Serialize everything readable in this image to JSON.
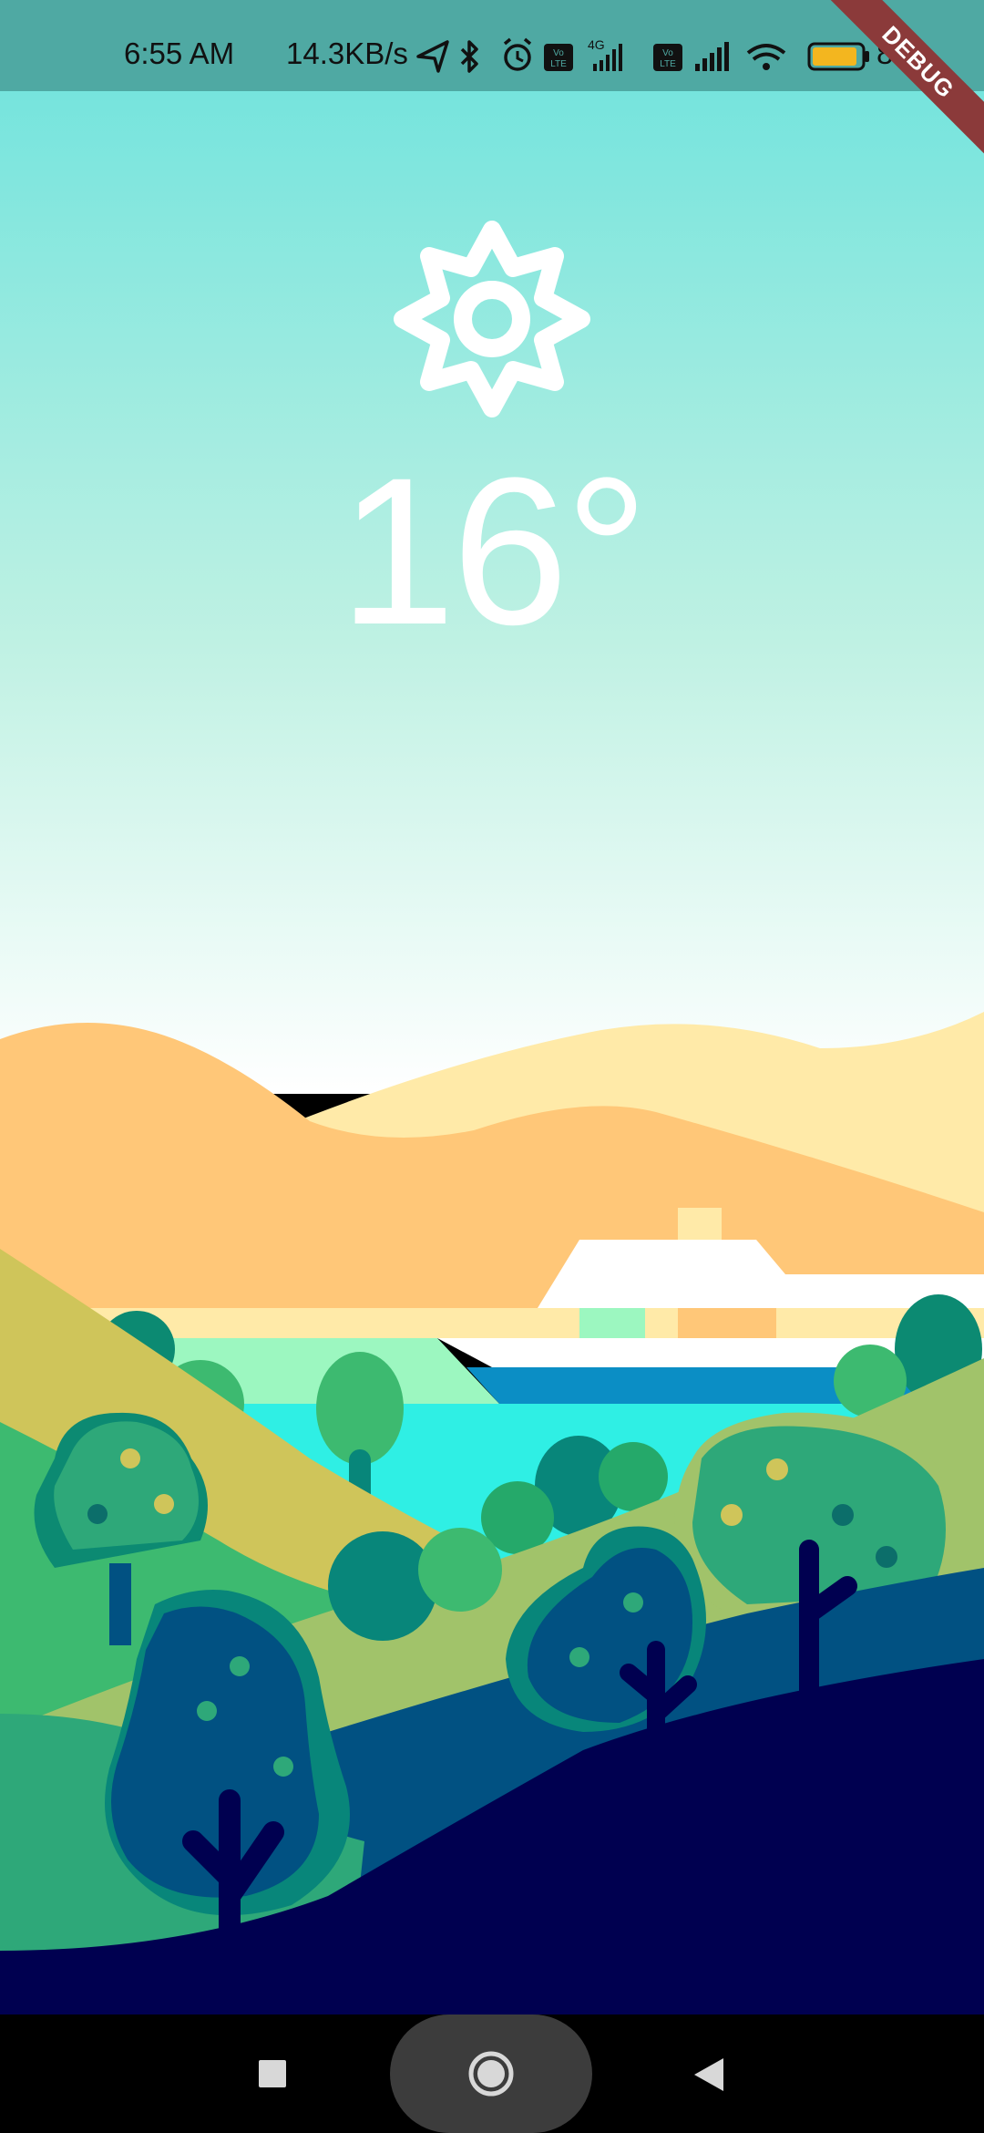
{
  "status_bar": {
    "time": "6:55 AM",
    "network_speed": "14.3KB/s",
    "battery_percent": "84",
    "icons": [
      "location-arrow-icon",
      "bluetooth-icon",
      "alarm-icon",
      "volte-icon",
      "signal-4g-icon",
      "volte-icon",
      "signal-icon",
      "wifi-icon",
      "battery-icon"
    ]
  },
  "debug_banner": "DEBUG",
  "weather": {
    "icon": "sun-icon",
    "temperature": "16°"
  },
  "colors": {
    "sky_top": "#76e4dd",
    "sky_bottom": "#ffffff",
    "status_bar": "#4fa9a3",
    "battery_fill": "#f3b61f"
  },
  "navigation": {
    "recents": "recents-square-icon",
    "home": "home-circle-icon",
    "back": "back-triangle-icon"
  }
}
